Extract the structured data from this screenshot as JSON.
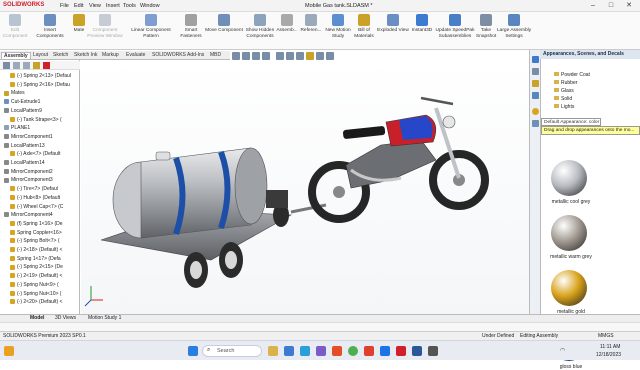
{
  "app": {
    "logo": "SOLIDWORKS",
    "document_title": "Mobile Gas tank.SLDASM *"
  },
  "menu": {
    "items": [
      "File",
      "Edit",
      "View",
      "Insert",
      "Tools",
      "Window"
    ]
  },
  "window_controls": {
    "minimize": "–",
    "maximize": "□",
    "close": "✕"
  },
  "ribbon": {
    "buttons": [
      {
        "label": "Edit\nComponent",
        "color": "#8aa0b8"
      },
      {
        "label": "Insert Components",
        "color": "#6d8fc0"
      },
      {
        "label": "Mate",
        "color": "#c9a227"
      },
      {
        "label": "Component\nPreview Window",
        "color": "#9aa7b3"
      },
      {
        "label": "Linear Component Pattern",
        "color": "#7f9ed0"
      },
      {
        "label": "Smart\nFasteners",
        "color": "#a0a0a0"
      },
      {
        "label": "Move Component",
        "color": "#6f8fb9"
      },
      {
        "label": "Show Hidden\nComponents",
        "color": "#8da2bc"
      },
      {
        "label": "Assemb...",
        "color": "#a9a9a9"
      },
      {
        "label": "Referen...",
        "color": "#9aa9bb"
      },
      {
        "label": "New Motion\nStudy",
        "color": "#5c8fd0"
      },
      {
        "label": "Bill of\nMaterials",
        "color": "#c9a227"
      },
      {
        "label": "Exploded View",
        "color": "#6b8fc5"
      },
      {
        "label": "Instant3D",
        "color": "#3c7bd1"
      },
      {
        "label": "Update SpeedPak\nSubassemblies",
        "color": "#4a7fc8"
      },
      {
        "label": "Take\nSnapshot",
        "color": "#7e8fa3"
      },
      {
        "label": "Large Assembly\nSettings",
        "color": "#5a86c0"
      }
    ]
  },
  "command_tabs": [
    "Assembly",
    "Layout",
    "Sketch",
    "Sketch Ink",
    "Markup",
    "Evaluate",
    "SOLIDWORKS Add-Ins",
    "MBD"
  ],
  "feature_tree": [
    {
      "label": "(-) Spring 2<13> (Defaul",
      "color": "#d9a520"
    },
    {
      "label": "(-) Spring 2<16> (Defau",
      "color": "#d9a520"
    },
    {
      "label": "Mates",
      "color": "#c9a227"
    },
    {
      "label": "Cut-Extrude1",
      "color": "#6d8fc0"
    },
    {
      "label": "LocalPattern9",
      "color": "#888"
    },
    {
      "label": "(-) Tank Strape<3> (",
      "color": "#d9a520"
    },
    {
      "label": "PLANE1",
      "color": "#8aa0b8"
    },
    {
      "label": "MirrorComponent1",
      "color": "#888"
    },
    {
      "label": "LocalPattern13",
      "color": "#888"
    },
    {
      "label": "(-) Axle<7> (Default",
      "color": "#d9a520"
    },
    {
      "label": "LocalPattern14",
      "color": "#888"
    },
    {
      "label": "MirrorComponent2",
      "color": "#888"
    },
    {
      "label": "MirrorComponent3",
      "color": "#888"
    },
    {
      "label": "(-) Tire<7> (Defaul",
      "color": "#d9a520"
    },
    {
      "label": "(-) Hub<8> (Default",
      "color": "#d9a520"
    },
    {
      "label": "(-) Wheel Cap<7> (C",
      "color": "#d9a520"
    },
    {
      "label": "MirrorComponent4",
      "color": "#888"
    },
    {
      "label": "(f) Spring 1<16> (De",
      "color": "#d9a520"
    },
    {
      "label": "Spring Coppler<16>",
      "color": "#d9a520"
    },
    {
      "label": "(-) Spring Bolt<7> (",
      "color": "#d9a520"
    },
    {
      "label": "(-) 2<18> (Default) <",
      "color": "#d9a520"
    },
    {
      "label": "Spring 1<17> (Defa",
      "color": "#d9a520"
    },
    {
      "label": "(-) Spring 2<15> (De",
      "color": "#d9a520"
    },
    {
      "label": "(-) 2<19> (Default) <",
      "color": "#d9a520"
    },
    {
      "label": "(-) Spring Nut<9> (",
      "color": "#d9a520"
    },
    {
      "label": "(-) Spring Nut<10> (",
      "color": "#d9a520"
    },
    {
      "label": "(-) 2<20> (Default) <",
      "color": "#d9a520"
    }
  ],
  "right_panel": {
    "title": "Appearances, Scenes, and Decals",
    "items": [
      "Powder Coat",
      "Rubber",
      "Glass",
      "Solid",
      "Lights"
    ],
    "tooltip_title": "Default Appearance: color",
    "tooltip_hint": "Drag and drop appearances onto the mo...",
    "swatches": [
      {
        "label": "metallic cool grey",
        "color": "#b8bcc2"
      },
      {
        "label": "metallic warm grey",
        "color": "#a39c93"
      },
      {
        "label": "metallic gold",
        "color": "#d8a21a"
      },
      {
        "label": "gloss blue",
        "color": "#1d6fd0"
      }
    ]
  },
  "bottom_tabs": [
    "Model",
    "3D Views",
    "Motion Study 1"
  ],
  "status": {
    "left": "SOLIDWORKS Premium 2023 SP0.1",
    "mid1": "Under Defined",
    "mid2": "Editing Assembly",
    "units": "MMGS"
  },
  "taskbar": {
    "search_placeholder": "Search",
    "time": "11:11 AM",
    "date": "12/18/2023"
  }
}
